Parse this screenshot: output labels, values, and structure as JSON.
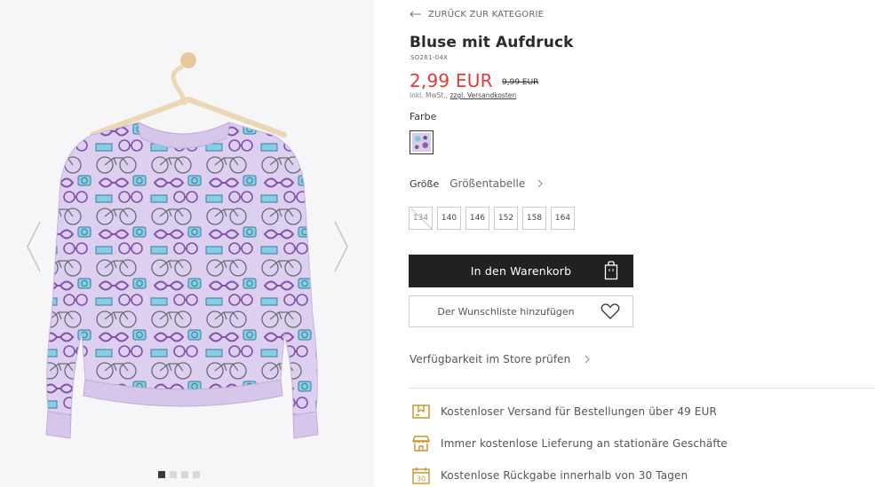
{
  "back_link": {
    "label": "ZURÜCK ZUR KATEGORIE"
  },
  "product": {
    "title": "Bluse mit Aufdruck",
    "sku": "SO281-04X",
    "price": "2,99 EUR",
    "old_price": "9,99 EUR",
    "tax_prefix": "inkl. MwSt.,",
    "shipping_link": "zzgl. Versandkosten"
  },
  "color": {
    "label": "Farbe"
  },
  "size": {
    "label": "Größe",
    "table_link": "Größentabelle",
    "options": [
      {
        "label": "134",
        "available": false
      },
      {
        "label": "140",
        "available": true
      },
      {
        "label": "146",
        "available": true
      },
      {
        "label": "152",
        "available": true
      },
      {
        "label": "158",
        "available": true
      },
      {
        "label": "164",
        "available": true
      }
    ]
  },
  "actions": {
    "add_to_cart": "In den Warenkorb",
    "add_to_wishlist": "Der Wunschliste hinzufügen",
    "store_availability": "Verfügbarkeit im Store prüfen"
  },
  "benefits": [
    {
      "icon": "delivery-box-icon",
      "label": "Kostenloser Versand für Bestellungen über 49 EUR"
    },
    {
      "icon": "store-icon",
      "label": "Immer kostenlose Lieferung an stationäre Geschäfte"
    },
    {
      "icon": "calendar-30-icon",
      "label": "Kostenlose Rückgabe innerhalb von 30 Tagen"
    }
  ],
  "gallery": {
    "image_count": 4,
    "active_index": 0
  },
  "colors": {
    "price_red": "#e23a36",
    "button_dark": "#212121",
    "icon_gold": "#c9962f",
    "garment_lilac": "#d9ccea"
  }
}
